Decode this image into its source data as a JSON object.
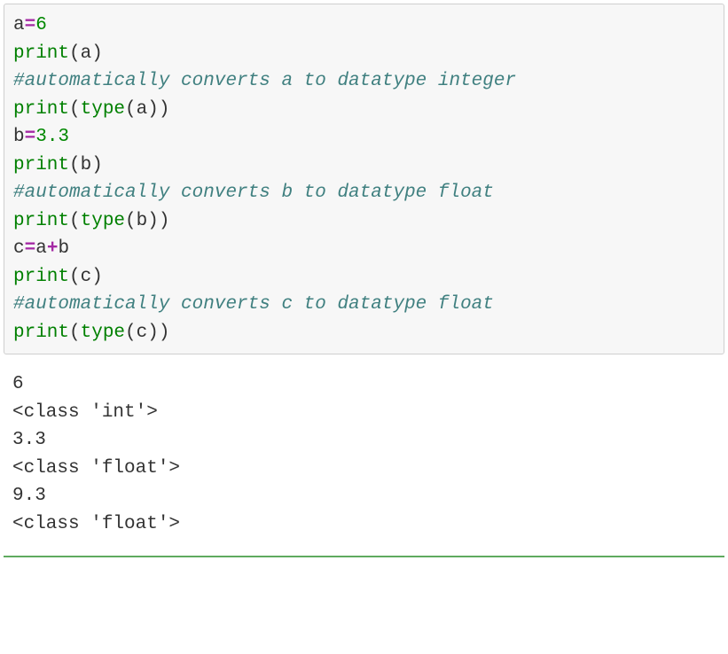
{
  "code": {
    "l1_id": "a",
    "l1_op": "=",
    "l1_num": "6",
    "l2_builtin": "print",
    "l2_open": "(",
    "l2_arg": "a",
    "l2_close": ")",
    "l3_comment": "#automatically converts a to datatype integer",
    "l4_builtin": "print",
    "l4_open": "(",
    "l4_builtin2": "type",
    "l4_open2": "(",
    "l4_arg": "a",
    "l4_close": "))",
    "l5_id": "b",
    "l5_op": "=",
    "l5_num": "3.3",
    "l6_builtin": "print",
    "l6_open": "(",
    "l6_arg": "b",
    "l6_close": ")",
    "l7_comment": "#automatically converts b to datatype float",
    "l8_builtin": "print",
    "l8_open": "(",
    "l8_builtin2": "type",
    "l8_open2": "(",
    "l8_arg": "b",
    "l8_close": "))",
    "l9_id": "c",
    "l9_op1": "=",
    "l9_arg1": "a",
    "l9_op2": "+",
    "l9_arg2": "b",
    "l10_builtin": "print",
    "l10_open": "(",
    "l10_arg": "c",
    "l10_close": ")",
    "l11_comment": "#automatically converts c to datatype float",
    "l12_builtin": "print",
    "l12_open": "(",
    "l12_builtin2": "type",
    "l12_open2": "(",
    "l12_arg": "c",
    "l12_close": "))"
  },
  "output": {
    "l1": "6",
    "l2": "<class 'int'>",
    "l3": "3.3",
    "l4": "<class 'float'>",
    "l5": "9.3",
    "l6": "<class 'float'>"
  }
}
